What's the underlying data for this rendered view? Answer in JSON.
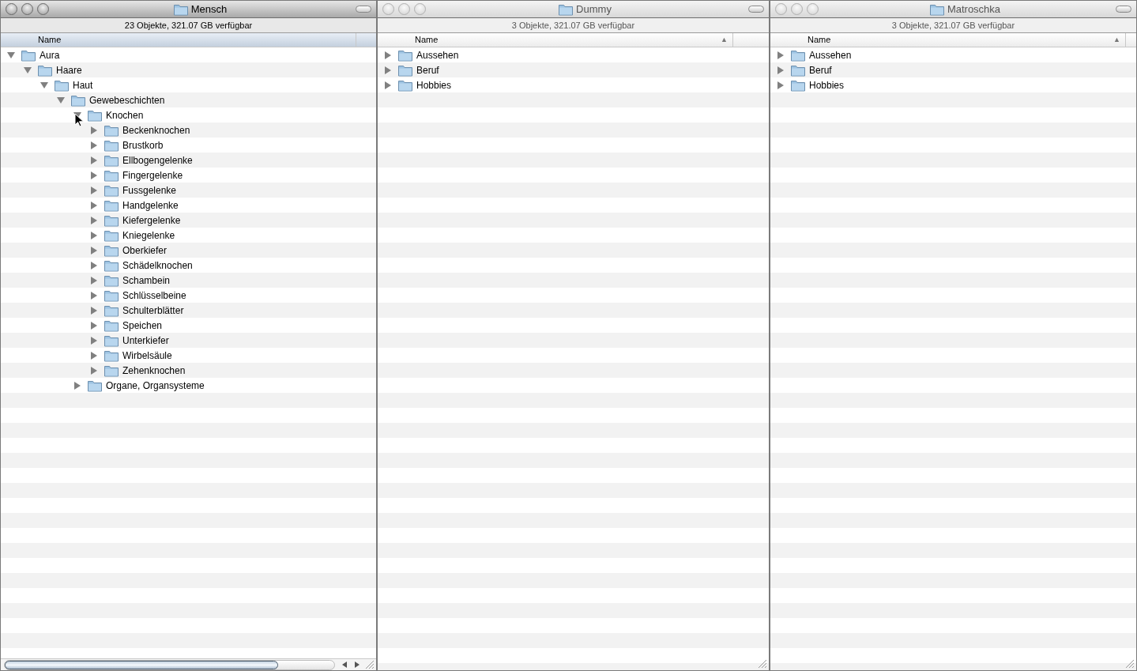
{
  "windows": [
    {
      "title": "Mensch",
      "active": true,
      "status": "23 Objekte, 321.07 GB verfügbar",
      "column": {
        "label": "Name",
        "selected": true
      },
      "horizontal_scrollbar": true,
      "items": [
        {
          "name": "Aura",
          "expanded": true,
          "children": [
            {
              "name": "Haare",
              "expanded": true,
              "children": [
                {
                  "name": "Haut",
                  "expanded": true,
                  "children": [
                    {
                      "name": "Gewebeschichten",
                      "expanded": true,
                      "children": [
                        {
                          "name": "Knochen",
                          "expanded": true,
                          "children": [
                            {
                              "name": "Beckenknochen",
                              "expanded": false
                            },
                            {
                              "name": "Brustkorb",
                              "expanded": false
                            },
                            {
                              "name": "Ellbogengelenke",
                              "expanded": false
                            },
                            {
                              "name": "Fingergelenke",
                              "expanded": false
                            },
                            {
                              "name": "Fussgelenke",
                              "expanded": false
                            },
                            {
                              "name": "Handgelenke",
                              "expanded": false
                            },
                            {
                              "name": "Kiefergelenke",
                              "expanded": false
                            },
                            {
                              "name": "Kniegelenke",
                              "expanded": false
                            },
                            {
                              "name": "Oberkiefer",
                              "expanded": false
                            },
                            {
                              "name": "Schädelknochen",
                              "expanded": false
                            },
                            {
                              "name": "Schambein",
                              "expanded": false
                            },
                            {
                              "name": "Schlüsselbeine",
                              "expanded": false
                            },
                            {
                              "name": "Schulterblätter",
                              "expanded": false
                            },
                            {
                              "name": "Speichen",
                              "expanded": false
                            },
                            {
                              "name": "Unterkiefer",
                              "expanded": false
                            },
                            {
                              "name": "Wirbelsäule",
                              "expanded": false
                            },
                            {
                              "name": "Zehenknochen",
                              "expanded": false
                            }
                          ]
                        },
                        {
                          "name": "Organe, Organsysteme",
                          "expanded": false
                        }
                      ]
                    }
                  ]
                }
              ]
            }
          ]
        }
      ]
    },
    {
      "title": "Dummy",
      "active": false,
      "status": "3 Objekte, 321.07 GB verfügbar",
      "column": {
        "label": "Name",
        "selected": false,
        "sort_indicator": "▲"
      },
      "horizontal_scrollbar": false,
      "items": [
        {
          "name": "Aussehen",
          "expanded": false
        },
        {
          "name": "Beruf",
          "expanded": false
        },
        {
          "name": "Hobbies",
          "expanded": false
        }
      ]
    },
    {
      "title": "Matroschka",
      "active": false,
      "status": "3 Objekte, 321.07 GB verfügbar",
      "column": {
        "label": "Name",
        "selected": false,
        "sort_indicator": "▲"
      },
      "horizontal_scrollbar": false,
      "items": [
        {
          "name": "Aussehen",
          "expanded": false
        },
        {
          "name": "Beruf",
          "expanded": false
        },
        {
          "name": "Hobbies",
          "expanded": false
        }
      ]
    }
  ]
}
